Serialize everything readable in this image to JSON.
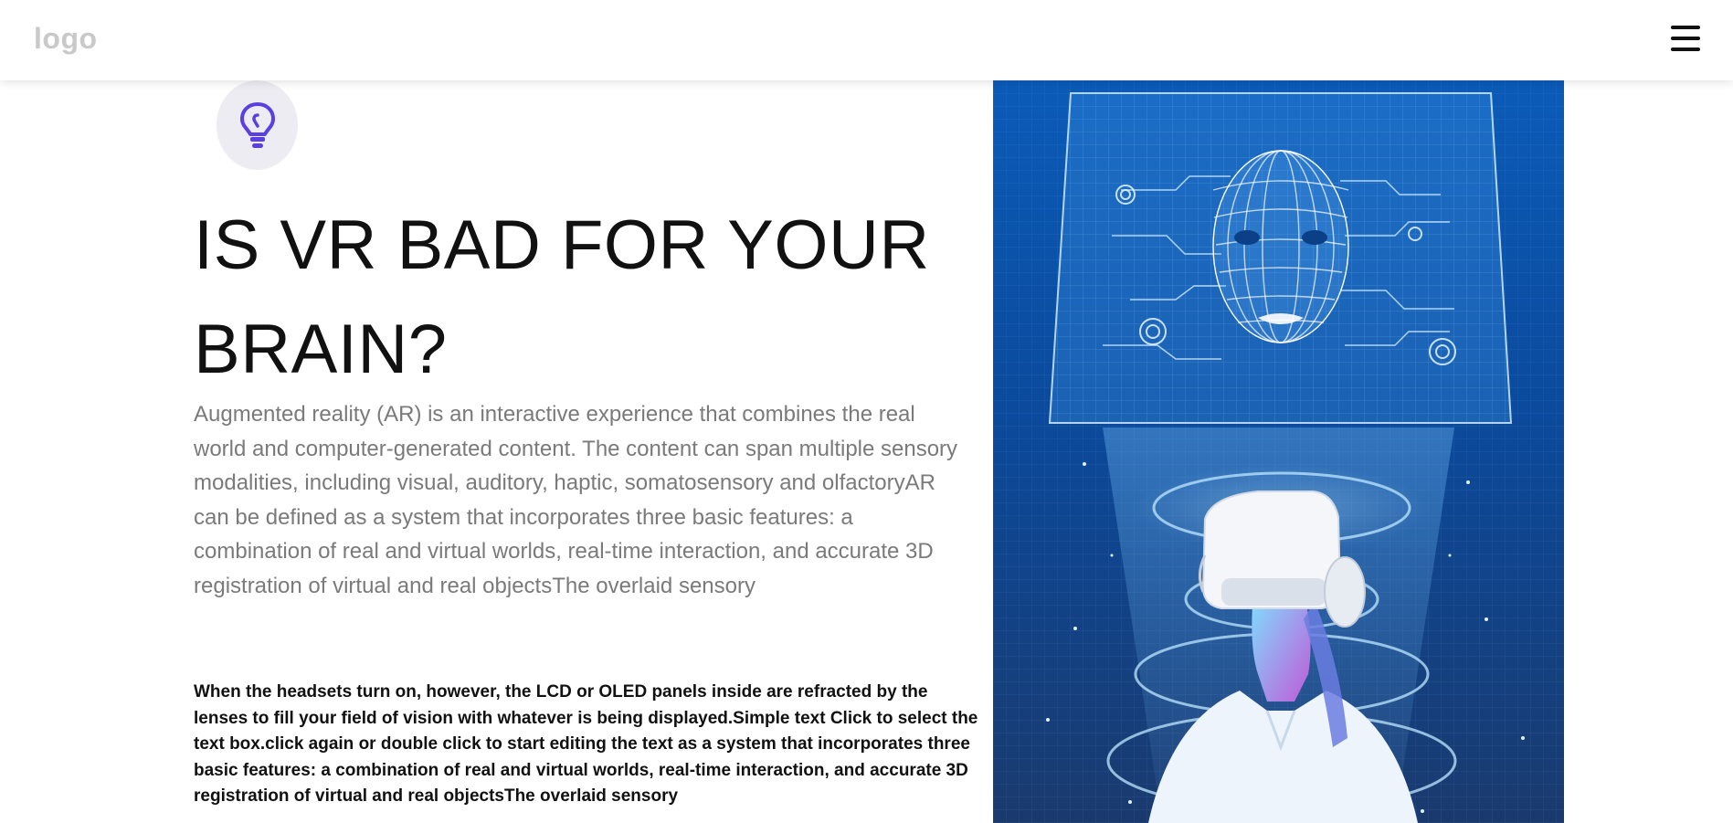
{
  "header": {
    "logo_text": "logo",
    "menu_icon": "hamburger-menu-icon"
  },
  "hero": {
    "icon": "lightbulb-icon",
    "accent_color": "#5b3fe0",
    "title": "IS VR BAD FOR YOUR BRAIN?",
    "description": "Augmented reality (AR) is an interactive experience that combines the real world and computer-generated content. The content can span multiple sensory modalities, including visual, auditory, haptic, somatosensory and olfactoryAR can be defined as a system that incorporates three basic features: a combination of real and virtual worlds, real-time interaction, and accurate 3D registration of virtual and real objectsThe overlaid sensory",
    "body": "When the headsets turn on, however, the LCD or OLED panels inside are refracted by the lenses to fill your field of vision with whatever is being displayed.Simple text Click to select the text box.click again or double click to start editing the text as a system that incorporates three basic features: a combination of real and virtual worlds, real-time interaction, and accurate 3D registration of virtual and real objectsThe overlaid sensory"
  },
  "image": {
    "subject": "woman-wearing-vr-headset-with-wireframe-face",
    "background_color": "#0b4a9c"
  }
}
